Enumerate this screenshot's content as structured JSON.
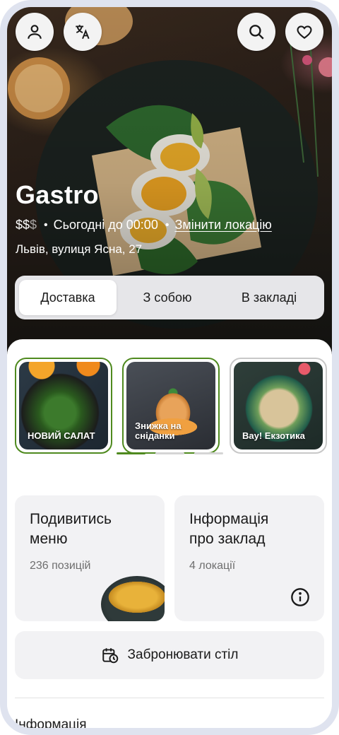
{
  "header": {
    "buttons": [
      {
        "icon": "profile-icon"
      },
      {
        "icon": "translate-icon"
      },
      {
        "icon": "search-icon"
      },
      {
        "icon": "heart-icon"
      }
    ]
  },
  "venue": {
    "name": "Gastro",
    "price_active": "$$",
    "price_inactive": "$",
    "hours": "Сьогодні до 00:00",
    "change_location": "Змінити локацію",
    "address": "Львів, вулиця Ясна, 27"
  },
  "service_tabs": {
    "selected": "Доставка",
    "items": [
      "Доставка",
      "З собою",
      "В закладі"
    ]
  },
  "stories": [
    {
      "label": "НОВИЙ САЛАТ",
      "seen": false
    },
    {
      "label": "Знижка на сніданки",
      "seen": false
    },
    {
      "label": "Вау! Екзотика",
      "seen": true
    }
  ],
  "stories_pager": {
    "pages": 3,
    "current": 1
  },
  "cards": {
    "menu": {
      "title": "Подивитись меню",
      "subtitle": "236 позицій"
    },
    "info": {
      "title": "Інформація про заклад",
      "subtitle": "4 локації",
      "icon": "info-icon"
    }
  },
  "booking": {
    "label": "Забронювати стіл",
    "icon": "calendar-clock-icon"
  },
  "sections": {
    "info_heading": "Інформація"
  },
  "colors": {
    "accent": "#4f8a1f",
    "card_bg": "#f2f2f4",
    "frame": "#dfe3ef"
  }
}
